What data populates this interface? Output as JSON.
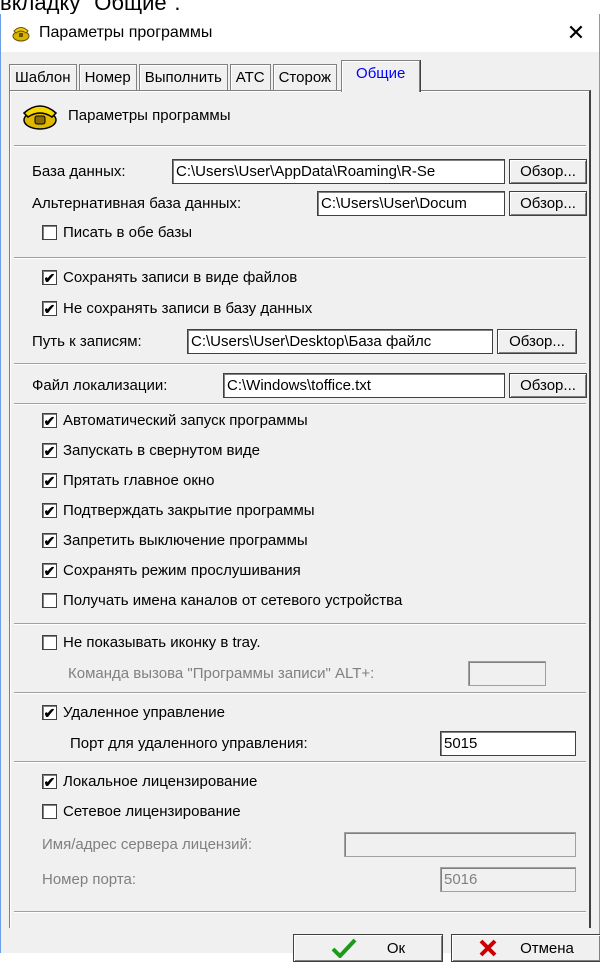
{
  "top_text": "вкладку \"Общие\".",
  "window": {
    "title": "Параметры программы",
    "close_symbol": "✕"
  },
  "tabs": [
    "Шаблон",
    "Номер",
    "Выполнить",
    "АТС",
    "Сторож",
    "Общие"
  ],
  "header": {
    "label": "Параметры программы"
  },
  "db": {
    "label": "База данных:",
    "value": "C:\\Users\\User\\AppData\\Roaming\\R-Se",
    "browse": "Обзор..."
  },
  "alt_db": {
    "label": "Альтернативная база данных:",
    "value": "C:\\Users\\User\\Docum",
    "browse": "Обзор..."
  },
  "write_both": {
    "label": "Писать в обе базы",
    "checked": false
  },
  "save_files": {
    "label": "Сохранять записи в виде файлов",
    "checked": true
  },
  "no_save_db": {
    "label": "Не сохранять записи в базу данных",
    "checked": true
  },
  "records_path": {
    "label": "Путь к записям:",
    "value": "C:\\Users\\User\\Desktop\\База файлс",
    "browse": "Обзор..."
  },
  "locale_file": {
    "label": "Файл локализации:",
    "value": "C:\\Windows\\toffice.txt",
    "browse": "Обзор..."
  },
  "options": [
    {
      "label": "Автоматический запуск программы",
      "checked": true
    },
    {
      "label": "Запускать в свернутом виде",
      "checked": true
    },
    {
      "label": "Прятать главное окно",
      "checked": true
    },
    {
      "label": "Подтверждать закрытие программы",
      "checked": true
    },
    {
      "label": "Запретить выключение программы",
      "checked": true
    },
    {
      "label": "Сохранять режим прослушивания",
      "checked": true
    },
    {
      "label": "Получать имена каналов от сетевого устройства",
      "checked": false
    }
  ],
  "tray": {
    "label": "Не показывать иконку в tray.",
    "checked": false,
    "hotkey_label": "Команда вызова \"Программы записи\" ALT+:",
    "hotkey_value": ""
  },
  "remote": {
    "label": "Удаленное управление",
    "checked": true,
    "port_label": "Порт для удаленного управления:",
    "port_value": "5015"
  },
  "license": {
    "local_label": "Локальное лицензирование",
    "local_checked": true,
    "network_label": "Сетевое лицензирование",
    "network_checked": false,
    "server_label": "Имя/адрес сервера лицензий:",
    "server_value": "",
    "port_label": "Номер порта:",
    "port_value": "5016"
  },
  "buttons": {
    "ok": "Ок",
    "cancel": "Отмена"
  },
  "check_mark": "✔"
}
